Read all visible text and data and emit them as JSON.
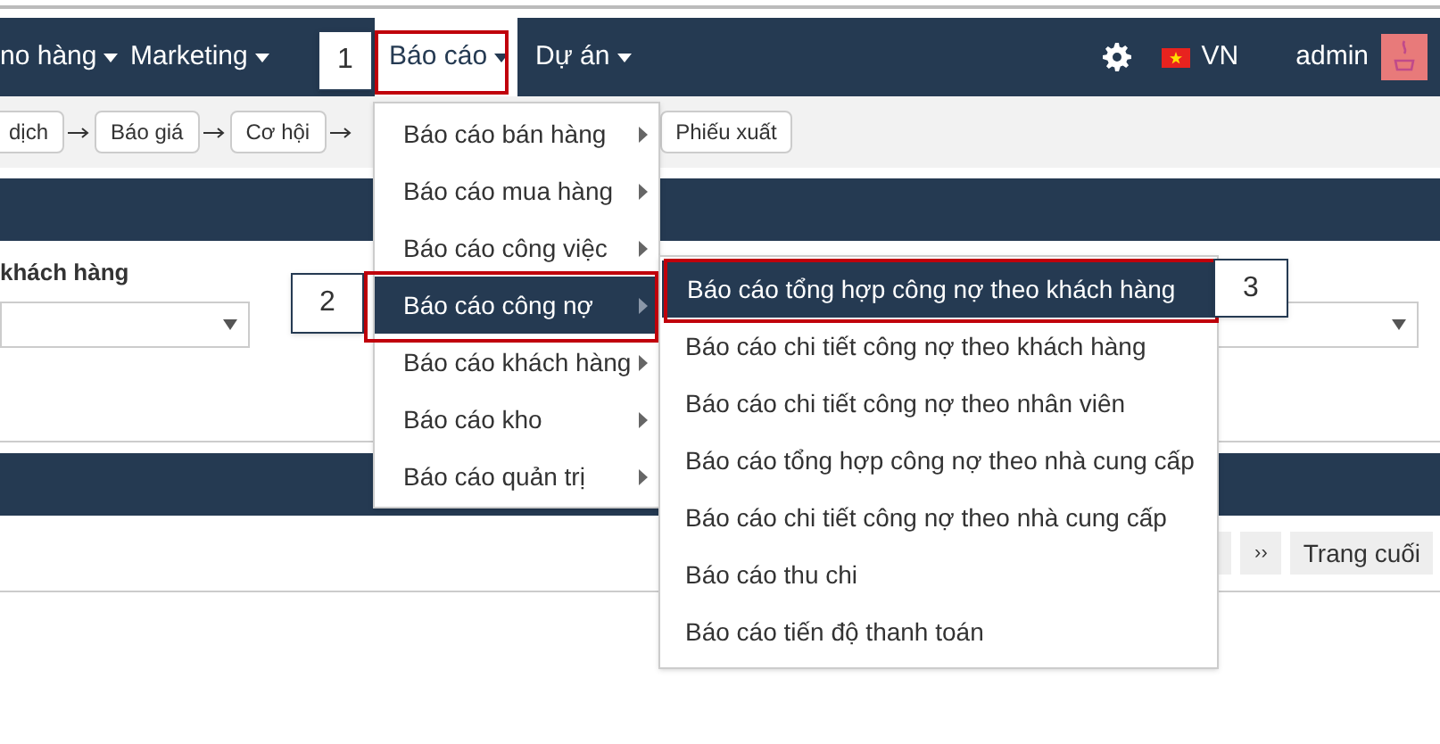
{
  "nav": {
    "items": [
      {
        "label": "no hàng",
        "caret": true,
        "selected": false
      },
      {
        "label": "Marketing",
        "caret": true,
        "selected": false
      },
      {
        "label": "Báo cáo",
        "caret": true,
        "selected": true
      },
      {
        "label": "Dự án",
        "caret": true,
        "selected": false
      }
    ],
    "language": "VN",
    "user": "admin"
  },
  "flow_steps": [
    {
      "label": "dịch"
    },
    {
      "label": "Báo giá"
    },
    {
      "label": "Cơ hội"
    },
    {
      "label": "Phiếu xuất"
    }
  ],
  "filters": [
    {
      "label": "khách hàng"
    }
  ],
  "pagination": [
    "››",
    "Trang cuối"
  ],
  "menu": {
    "items": [
      {
        "label": "Báo cáo bán hàng",
        "selected": false
      },
      {
        "label": "Báo cáo mua hàng",
        "selected": false
      },
      {
        "label": "Báo cáo công việc",
        "selected": false
      },
      {
        "label": "Báo cáo công nợ",
        "selected": true
      },
      {
        "label": "Báo cáo khách hàng",
        "selected": false
      },
      {
        "label": "Báo cáo kho",
        "selected": false
      },
      {
        "label": "Báo cáo quản trị",
        "selected": false
      }
    ],
    "submenu": [
      {
        "label": "Báo cáo tổng hợp công nợ theo khách hàng",
        "selected": true
      },
      {
        "label": "Báo cáo chi tiết công nợ theo khách hàng",
        "selected": false
      },
      {
        "label": "Báo cáo chi tiết công nợ theo nhân viên",
        "selected": false
      },
      {
        "label": "Báo cáo tổng hợp công nợ theo nhà cung cấp",
        "selected": false
      },
      {
        "label": "Báo cáo chi tiết công nợ theo nhà cung cấp",
        "selected": false
      },
      {
        "label": "Báo cáo thu chi",
        "selected": false
      },
      {
        "label": "Báo cáo tiến độ thanh toán",
        "selected": false
      }
    ]
  },
  "callouts": [
    "1",
    "2",
    "3"
  ]
}
